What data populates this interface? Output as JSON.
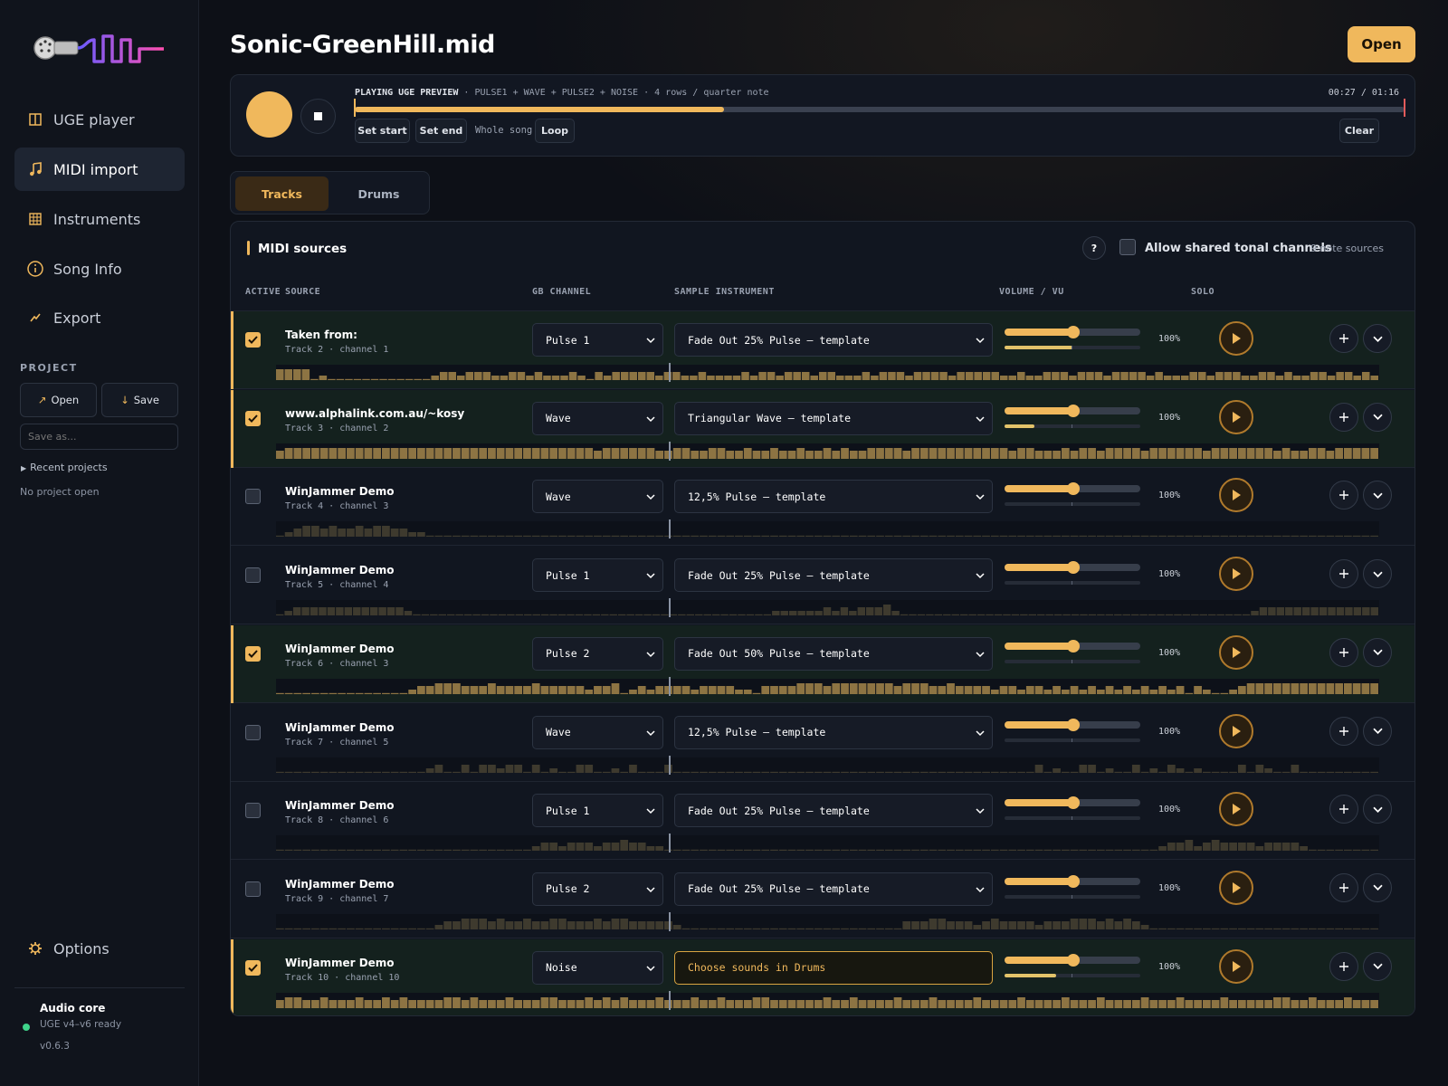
{
  "sidebar": {
    "nav": [
      {
        "label": "UGE player",
        "icon": "columns-icon"
      },
      {
        "label": "MIDI import",
        "icon": "music-note-icon",
        "active": true
      },
      {
        "label": "Instruments",
        "icon": "grid-icon"
      },
      {
        "label": "Song Info",
        "icon": "info-icon"
      },
      {
        "label": "Export",
        "icon": "export-icon"
      }
    ],
    "project_label": "PROJECT",
    "open_label": "Open",
    "save_label": "Save",
    "save_as_placeholder": "Save as...",
    "recent_label": "Recent projects",
    "no_project": "No project open",
    "options_label": "Options",
    "audio": {
      "title": "Audio core",
      "status": "UGE v4–v6 ready",
      "version": "v0.6.3",
      "status_color": "#3fd48a"
    }
  },
  "header": {
    "title": "Sonic-GreenHill.mid",
    "open_label": "Open"
  },
  "player": {
    "status_prefix": "PLAYING UGE PREVIEW",
    "status_rest": " · PULSE1 + WAVE + PULSE2 + NOISE · 4 rows / quarter note",
    "time": "00:27 / 01:16",
    "progress": 0.352,
    "set_start": "Set start",
    "set_end": "Set end",
    "whole_song": "Whole song",
    "loop": "Loop",
    "clear": "Clear"
  },
  "tabs": [
    {
      "label": "Tracks",
      "active": true
    },
    {
      "label": "Drums",
      "active": false
    }
  ],
  "panel": {
    "title": "MIDI sources",
    "help": "?",
    "shared_label": "Allow shared tonal channels",
    "shared_checked": false,
    "sources_count": "9 note sources",
    "columns": {
      "active": "ACTIVE",
      "source": "SOURCE",
      "gb_channel": "GB CHANNEL",
      "sample": "SAMPLE INSTRUMENT",
      "volume": "VOLUME / VU",
      "solo": "SOLO"
    }
  },
  "tracks": [
    {
      "active": true,
      "name": "Taken from:",
      "sub": "Track 2 · channel 1",
      "channel": "Pulse 1",
      "instrument": "Fade Out 25% Pulse — template",
      "volume": "100%",
      "vu": 0.5,
      "roll": [
        3,
        3,
        3,
        3,
        0,
        1,
        0,
        0,
        0,
        0,
        0,
        0,
        0,
        0,
        0,
        0,
        0,
        0,
        1,
        2,
        2,
        1,
        2,
        2,
        2,
        1,
        1,
        2,
        2,
        1,
        2,
        1,
        1,
        1,
        2,
        1,
        0,
        2,
        1,
        2,
        2,
        2,
        2,
        2,
        1,
        2,
        2,
        1,
        1,
        2,
        1,
        1,
        1,
        1,
        2,
        1,
        2,
        2,
        1,
        2,
        2,
        2,
        1,
        2,
        2,
        1,
        1,
        1,
        2,
        1,
        2,
        2,
        2,
        1,
        2,
        2,
        2,
        2,
        1,
        2,
        2,
        2,
        2,
        2,
        1,
        1,
        2,
        1,
        1,
        2,
        2,
        2,
        1,
        2,
        2,
        2,
        1,
        2,
        2,
        2,
        2,
        1,
        2,
        1,
        1,
        1,
        2,
        2,
        1,
        2,
        2,
        2,
        1,
        1,
        2,
        2,
        1,
        2,
        1,
        1,
        2,
        2,
        1,
        2,
        2,
        1,
        2,
        1
      ]
    },
    {
      "active": true,
      "name": "www.alphalink.com.au/~kosy",
      "sub": "Track 3 · channel 2",
      "channel": "Wave",
      "instrument": "Triangular Wave — template",
      "volume": "100%",
      "vu": 0.22,
      "roll": [
        2,
        3,
        3,
        3,
        3,
        3,
        3,
        3,
        3,
        3,
        3,
        3,
        3,
        3,
        3,
        3,
        3,
        3,
        3,
        3,
        3,
        3,
        3,
        3,
        3,
        3,
        3,
        3,
        3,
        3,
        3,
        3,
        3,
        3,
        3,
        3,
        2,
        3,
        3,
        3,
        3,
        3,
        3,
        2,
        2,
        3,
        3,
        2,
        2,
        3,
        3,
        2,
        2,
        3,
        2,
        2,
        3,
        2,
        2,
        3,
        2,
        2,
        3,
        2,
        3,
        2,
        2,
        3,
        3,
        3,
        3,
        2,
        3,
        3,
        3,
        3,
        3,
        3,
        3,
        3,
        3,
        3,
        3,
        2,
        3,
        3,
        2,
        2,
        2,
        3,
        2,
        3,
        3,
        2,
        3,
        3,
        3,
        3,
        2,
        3,
        3,
        3,
        3,
        3,
        3,
        2,
        3,
        3,
        3,
        3,
        3,
        3,
        3,
        2,
        3,
        2,
        2,
        3,
        3,
        2,
        3,
        3,
        3,
        3,
        3
      ]
    },
    {
      "active": false,
      "name": "WinJammer Demo",
      "sub": "Track 4 · channel 3",
      "channel": "Wave",
      "instrument": "12,5% Pulse — template",
      "volume": "100%",
      "vu": 0,
      "roll": [
        0,
        1,
        2,
        3,
        3,
        2,
        3,
        2,
        2,
        3,
        2,
        3,
        3,
        2,
        2,
        1,
        1,
        0,
        0,
        0,
        0,
        0,
        0,
        0,
        0,
        0,
        0,
        0,
        0,
        0,
        0,
        0,
        0,
        0,
        0,
        0,
        0,
        0,
        0,
        0,
        0,
        0,
        0,
        0,
        0,
        0,
        0,
        0,
        0,
        0,
        0,
        0,
        0,
        0,
        0,
        0,
        0,
        0,
        0,
        0,
        0,
        0,
        0,
        0,
        0,
        0,
        0,
        0,
        0,
        0,
        0,
        0,
        0,
        0,
        0,
        0,
        0,
        0,
        0,
        0,
        0,
        0,
        0,
        0,
        0,
        0,
        0,
        0,
        0,
        0,
        0,
        0,
        0,
        0,
        0,
        0,
        0,
        0,
        0,
        0,
        0,
        0,
        0,
        0,
        0,
        0,
        0,
        0,
        0,
        0,
        0,
        0,
        0,
        0,
        0,
        0,
        0,
        0,
        0,
        0,
        0,
        0,
        0,
        0,
        0
      ]
    },
    {
      "active": false,
      "name": "WinJammer Demo",
      "sub": "Track 5 · channel 4",
      "channel": "Pulse 1",
      "instrument": "Fade Out 25% Pulse — template",
      "volume": "100%",
      "vu": 0,
      "roll": [
        0,
        1,
        2,
        2,
        2,
        2,
        2,
        2,
        2,
        2,
        2,
        2,
        2,
        2,
        2,
        1,
        0,
        0,
        0,
        0,
        0,
        0,
        0,
        0,
        0,
        0,
        0,
        0,
        0,
        0,
        0,
        0,
        0,
        0,
        0,
        0,
        0,
        0,
        0,
        0,
        0,
        0,
        0,
        0,
        0,
        0,
        0,
        0,
        0,
        0,
        0,
        0,
        0,
        0,
        0,
        0,
        0,
        0,
        1,
        1,
        1,
        1,
        1,
        1,
        2,
        1,
        2,
        1,
        2,
        2,
        2,
        3,
        1,
        0,
        0,
        0,
        0,
        0,
        0,
        0,
        0,
        0,
        0,
        0,
        0,
        0,
        0,
        0,
        0,
        0,
        0,
        0,
        0,
        0,
        0,
        0,
        0,
        0,
        0,
        0,
        0,
        0,
        0,
        0,
        0,
        0,
        0,
        0,
        0,
        0,
        0,
        0,
        0,
        0,
        1,
        2,
        2,
        2,
        2,
        2,
        2,
        2,
        2,
        2,
        2,
        2,
        2,
        2,
        2
      ]
    },
    {
      "active": true,
      "name": "WinJammer Demo",
      "sub": "Track 6 · channel 3",
      "channel": "Pulse 2",
      "instrument": "Fade Out 50% Pulse — template",
      "volume": "100%",
      "vu": 0,
      "roll": [
        0,
        0,
        0,
        0,
        0,
        0,
        0,
        0,
        0,
        0,
        0,
        0,
        0,
        0,
        0,
        1,
        2,
        2,
        3,
        3,
        3,
        2,
        2,
        2,
        3,
        2,
        2,
        2,
        2,
        3,
        2,
        2,
        2,
        2,
        2,
        1,
        2,
        2,
        3,
        0,
        1,
        2,
        1,
        2,
        2,
        2,
        2,
        1,
        2,
        2,
        2,
        2,
        1,
        1,
        0,
        2,
        2,
        2,
        2,
        3,
        3,
        3,
        2,
        3,
        3,
        3,
        3,
        3,
        3,
        3,
        2,
        3,
        3,
        3,
        2,
        2,
        3,
        2,
        2,
        2,
        2,
        1,
        2,
        2,
        1,
        2,
        2,
        1,
        2,
        1,
        2,
        1,
        2,
        1,
        2,
        1,
        2,
        1,
        2,
        1,
        2,
        1,
        2,
        0,
        2,
        1,
        0,
        0,
        1,
        2,
        3,
        3,
        3,
        3,
        3,
        3,
        3,
        3,
        3,
        3,
        3,
        3,
        3,
        3,
        3
      ]
    },
    {
      "active": false,
      "name": "WinJammer Demo",
      "sub": "Track 7 · channel 5",
      "channel": "Wave",
      "instrument": "12,5% Pulse — template",
      "volume": "100%",
      "vu": 0,
      "roll": [
        0,
        0,
        0,
        0,
        0,
        0,
        0,
        0,
        0,
        0,
        0,
        0,
        0,
        0,
        0,
        0,
        0,
        1,
        2,
        0,
        0,
        2,
        0,
        2,
        2,
        1,
        2,
        2,
        0,
        2,
        0,
        1,
        0,
        0,
        2,
        2,
        0,
        0,
        1,
        0,
        2,
        0,
        0,
        0,
        2,
        0,
        0,
        0,
        0,
        0,
        0,
        0,
        0,
        0,
        0,
        0,
        0,
        0,
        0,
        0,
        0,
        0,
        0,
        0,
        0,
        0,
        0,
        0,
        0,
        0,
        0,
        0,
        0,
        0,
        0,
        0,
        0,
        0,
        0,
        0,
        0,
        0,
        0,
        0,
        0,
        0,
        2,
        0,
        1,
        0,
        0,
        2,
        2,
        0,
        1,
        0,
        0,
        2,
        0,
        1,
        0,
        2,
        1,
        0,
        1,
        0,
        0,
        0,
        0,
        2,
        0,
        2,
        1,
        0,
        0,
        2,
        0,
        0,
        0,
        0,
        0,
        0,
        0,
        0,
        0
      ]
    },
    {
      "active": false,
      "name": "WinJammer Demo",
      "sub": "Track 8 · channel 6",
      "channel": "Pulse 1",
      "instrument": "Fade Out 25% Pulse — template",
      "volume": "100%",
      "vu": 0,
      "roll": [
        0,
        0,
        0,
        0,
        0,
        0,
        0,
        0,
        0,
        0,
        0,
        0,
        0,
        0,
        0,
        0,
        0,
        0,
        0,
        0,
        0,
        0,
        0,
        0,
        0,
        0,
        0,
        0,
        0,
        1,
        2,
        2,
        1,
        2,
        2,
        2,
        1,
        2,
        2,
        3,
        2,
        2,
        1,
        1,
        0,
        0,
        0,
        0,
        0,
        0,
        0,
        0,
        0,
        0,
        0,
        0,
        0,
        0,
        0,
        0,
        0,
        0,
        0,
        0,
        0,
        0,
        0,
        0,
        0,
        0,
        0,
        0,
        0,
        0,
        0,
        0,
        0,
        0,
        0,
        0,
        0,
        0,
        0,
        0,
        0,
        0,
        0,
        0,
        0,
        0,
        0,
        0,
        0,
        0,
        0,
        0,
        0,
        0,
        0,
        0,
        1,
        2,
        2,
        3,
        1,
        2,
        3,
        2,
        2,
        2,
        2,
        1,
        2,
        2,
        2,
        2,
        1,
        0,
        0,
        0,
        0,
        0,
        0,
        0,
        0
      ]
    },
    {
      "active": false,
      "name": "WinJammer Demo",
      "sub": "Track 9 · channel 7",
      "channel": "Pulse 2",
      "instrument": "Fade Out 25% Pulse — template",
      "volume": "100%",
      "vu": 0,
      "roll": [
        0,
        0,
        0,
        0,
        0,
        0,
        0,
        0,
        0,
        0,
        0,
        0,
        0,
        0,
        0,
        0,
        0,
        0,
        1,
        2,
        2,
        3,
        3,
        3,
        2,
        3,
        2,
        2,
        3,
        2,
        2,
        3,
        3,
        2,
        2,
        2,
        3,
        2,
        3,
        3,
        2,
        2,
        2,
        2,
        2,
        1,
        0,
        0,
        0,
        0,
        0,
        0,
        0,
        0,
        0,
        0,
        0,
        0,
        0,
        0,
        0,
        0,
        0,
        0,
        0,
        0,
        0,
        0,
        0,
        0,
        0,
        2,
        2,
        2,
        3,
        3,
        2,
        2,
        2,
        1,
        2,
        3,
        2,
        2,
        2,
        2,
        1,
        2,
        2,
        2,
        3,
        3,
        3,
        2,
        3,
        2,
        3,
        2,
        1,
        0,
        0,
        0,
        0,
        0,
        0,
        0,
        0,
        0,
        0,
        0,
        0,
        0,
        0,
        0,
        0,
        0,
        0,
        0,
        0,
        0,
        0,
        0,
        0,
        0,
        0
      ]
    },
    {
      "active": true,
      "name": "WinJammer Demo",
      "sub": "Track 10 · channel 10",
      "channel": "Noise",
      "instrument": "Choose sounds in Drums",
      "instrument_warn": true,
      "volume": "100%",
      "vu": 0.38,
      "roll": [
        2,
        3,
        3,
        2,
        2,
        3,
        2,
        2,
        2,
        3,
        2,
        2,
        3,
        2,
        3,
        2,
        2,
        2,
        2,
        3,
        3,
        2,
        3,
        2,
        2,
        2,
        3,
        2,
        2,
        2,
        3,
        3,
        2,
        2,
        2,
        3,
        2,
        3,
        2,
        3,
        2,
        2,
        2,
        3,
        2,
        2,
        2,
        3,
        2,
        2,
        3,
        2,
        2,
        2,
        3,
        3,
        2,
        2,
        2,
        2,
        2,
        2,
        3,
        2,
        2,
        3,
        2,
        2,
        2,
        2,
        3,
        2,
        2,
        2,
        3,
        2,
        2,
        2,
        2,
        3,
        2,
        2,
        2,
        2,
        3,
        2,
        2,
        2,
        2,
        3,
        2,
        2,
        2,
        3,
        2,
        2,
        2,
        2,
        3,
        2,
        2,
        2,
        3,
        2,
        2,
        2,
        2,
        3,
        2,
        2,
        2,
        2,
        2,
        3,
        3,
        2,
        2,
        3,
        2,
        2,
        2,
        3,
        2,
        2,
        2
      ]
    }
  ]
}
